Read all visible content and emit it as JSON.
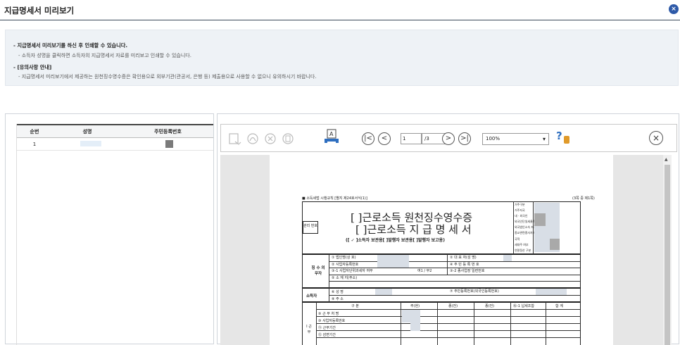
{
  "window": {
    "title": "지급명세서 미리보기",
    "close_label": "×"
  },
  "notice": {
    "item1_title": "- 지급명세서 미리보기를 하신 후 인쇄할 수 있습니다.",
    "item1_desc": "- 소득자 성명을 클릭하면 소득자의 지급명세서 자료를 미리보고 인쇄할 수 있습니다.",
    "item2_title": "- [유의사항 안내]",
    "item2_desc": "- 지급명세서 미리보기에서 제공하는 원천징수영수증은 확인용으로 외부기관(관공서, 은행 등) 제출용으로 사용할 수 없으니 유의하시기 바랍니다."
  },
  "grid": {
    "headers": [
      "순번",
      "성명",
      "주민등록번호"
    ],
    "rows": [
      {
        "no": "1"
      }
    ]
  },
  "viewer": {
    "first_label": "|<",
    "prev_label": "<",
    "next_label": ">",
    "last_label": ">|",
    "current_page": "1",
    "total_pages": "/3",
    "zoom": "100%",
    "help_label": "?",
    "close_label": "×"
  },
  "document": {
    "form_ref": "■ 소득세법 시행규칙 [별지 제24호서식(1)]",
    "page_info": "(3쪽 중 제1쪽)",
    "title1": "[ ]근로소득 원천징수영수증",
    "title2": "[ ]근로소득 지 급 명 세 서",
    "subtitle": "([ ✓ ]소득자 보관용[    ]발행자 보관용[    ]발행자 보고용)",
    "mgmt_no": "관리 번호",
    "right_labels": [
      "거주구분",
      "거주지국",
      "내 · 외국인",
      "외국인단일세율적",
      "외국법인소속 파견근로",
      "종교관련종사자 여",
      "국적",
      "세대주 여부",
      "연말정산 구분"
    ],
    "payer_label": "징 수 의무자",
    "payer_fields": [
      "① 법인명(상 호)",
      "② 사업자등록번호",
      "③-1 사업자단위과세자 여부",
      "⑤ 소 재 지(주소)"
    ],
    "payer_right": [
      "② 대 표 자(성 명)",
      "④ 주 민 등 록 번 호",
      "③-2 종사업장 일련번호"
    ],
    "yn_choice": "여1 / 부2",
    "earner_label": "소득자",
    "earner_fields": [
      "⑥ 성       명",
      "⑧ 주       소"
    ],
    "earner_right": "⑦ 주민등록번호(외국인등록번호)",
    "table_headers": [
      "구   분",
      "주(현)",
      "종(전)",
      "종(전)",
      "⑯-1 납세조합",
      "합  계"
    ],
    "table_rows": [
      "⑨ 근 무 처 명",
      "⑩ 사업자등록번호",
      "⑪ 근무기간",
      "⑫ 감면기간"
    ],
    "section_label": "Ⅰ 근 무"
  }
}
